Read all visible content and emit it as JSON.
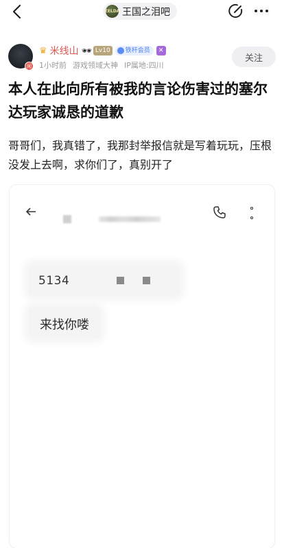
{
  "forum": {
    "name": "王国之泪吧",
    "avatar_text": "ZELDA"
  },
  "post": {
    "author": {
      "name": "米线山",
      "decoration": "🕶",
      "level": "Lv10",
      "member_label": "铁杆会员",
      "tag_glyph": "✕",
      "avatar_badge": "闲"
    },
    "meta": {
      "time": "1小时前",
      "honor": "游戏领域大神",
      "ip": "IP属地:四川"
    },
    "follow_label": "关注",
    "title": "本人在此向所有被我的言论伤害过的塞尔达玩家诚恳的道歉",
    "body": "哥哥们，我真错了，我那封举报信就是写着玩玩，压根没发上去啊，求你们了，真别开了"
  },
  "screenshot": {
    "messages": [
      {
        "text": "5134"
      },
      {
        "text": "来找你喽"
      }
    ]
  },
  "icons": {
    "back": "back-arrow-icon",
    "edit": "edit-icon",
    "more": "more-horizontal-icon",
    "phone": "phone-icon",
    "kebab": "more-vertical-icon"
  },
  "colors": {
    "username": "#e0584f",
    "member": "#4a7cf0",
    "meta": "#9a9a9a"
  }
}
